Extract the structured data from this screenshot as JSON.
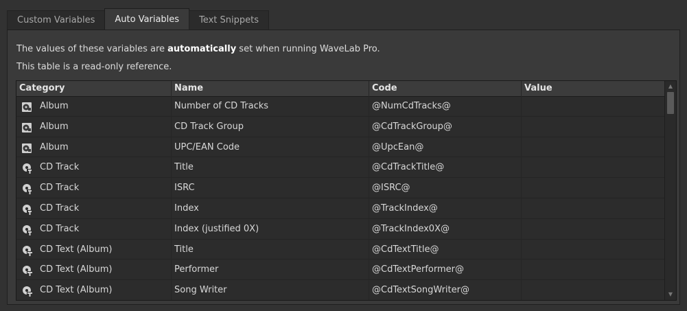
{
  "tabs": [
    {
      "label": "Custom Variables",
      "active": false
    },
    {
      "label": "Auto Variables",
      "active": true
    },
    {
      "label": "Text Snippets",
      "active": false
    }
  ],
  "description": {
    "line1_before": "The values of these variables are ",
    "line1_bold": "automatically",
    "line1_after": " set when running WaveLab Pro.",
    "line2": "This table is a read-only reference."
  },
  "table": {
    "headers": [
      "Category",
      "Name",
      "Code",
      "Value"
    ],
    "rows": [
      {
        "icon": "album-icon",
        "category": "Album",
        "name": "Number of CD Tracks",
        "code": "@NumCdTracks@",
        "value": ""
      },
      {
        "icon": "album-icon",
        "category": "Album",
        "name": "CD Track Group",
        "code": "@CdTrackGroup@",
        "value": ""
      },
      {
        "icon": "album-icon",
        "category": "Album",
        "name": "UPC/EAN Code",
        "code": "@UpcEan@",
        "value": ""
      },
      {
        "icon": "cd-track-icon",
        "category": "CD Track",
        "name": "Title",
        "code": "@CdTrackTitle@",
        "value": ""
      },
      {
        "icon": "cd-track-icon",
        "category": "CD Track",
        "name": "ISRC",
        "code": "@ISRC@",
        "value": ""
      },
      {
        "icon": "cd-track-icon",
        "category": "CD Track",
        "name": "Index",
        "code": "@TrackIndex@",
        "value": ""
      },
      {
        "icon": "cd-track-icon",
        "category": "CD Track",
        "name": "Index (justified 0X)",
        "code": "@TrackIndex0X@",
        "value": ""
      },
      {
        "icon": "cd-text-icon",
        "category": "CD Text (Album)",
        "name": "Title",
        "code": "@CdTextTitle@",
        "value": ""
      },
      {
        "icon": "cd-text-icon",
        "category": "CD Text (Album)",
        "name": "Performer",
        "code": "@CdTextPerformer@",
        "value": ""
      },
      {
        "icon": "cd-text-icon",
        "category": "CD Text (Album)",
        "name": "Song Writer",
        "code": "@CdTextSongWriter@",
        "value": ""
      }
    ]
  }
}
